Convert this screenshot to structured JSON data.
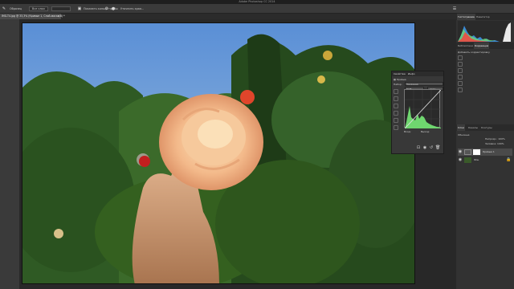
{
  "app": {
    "title": "Adobe Photoshop CC 2014"
  },
  "options_bar": {
    "items": [
      "Образец",
      "Все слои",
      "Показать кольцо пробы"
    ],
    "refine_label": "Уточнить края..."
  },
  "document": {
    "tab_title": "IMG-T4.jpg @ 33,3% (Кривые 1, Слой-маска/8) *"
  },
  "panels": {
    "top_tabs": [
      "Гистограмма",
      "Навигатор"
    ],
    "mid_tabs": [
      "Библиотеки",
      "Коррекция"
    ],
    "mid_title": "Добавить корректировку",
    "layers_tabs": [
      "Слои",
      "Каналы",
      "Контуры"
    ],
    "layers_kind": "Обычные",
    "layers_opacity_label": "Непрозр.:",
    "layers_opacity": "100%",
    "layers_fill_label": "Заливка:",
    "layers_fill": "100%",
    "layers": [
      {
        "name": "Кривые 1"
      },
      {
        "name": "Фон"
      }
    ]
  },
  "properties": {
    "tabs": [
      "Свойства",
      "Инфо"
    ],
    "title": "Кривые",
    "preset_label": "Набор:",
    "preset_value": "Заказная",
    "channel_value": "RGB",
    "auto_label": "Авто",
    "input_label": "Вход:",
    "output_label": "Выход:"
  },
  "colors": {
    "accent": "#4a90e2",
    "histogram_green": "#6fd66f"
  }
}
